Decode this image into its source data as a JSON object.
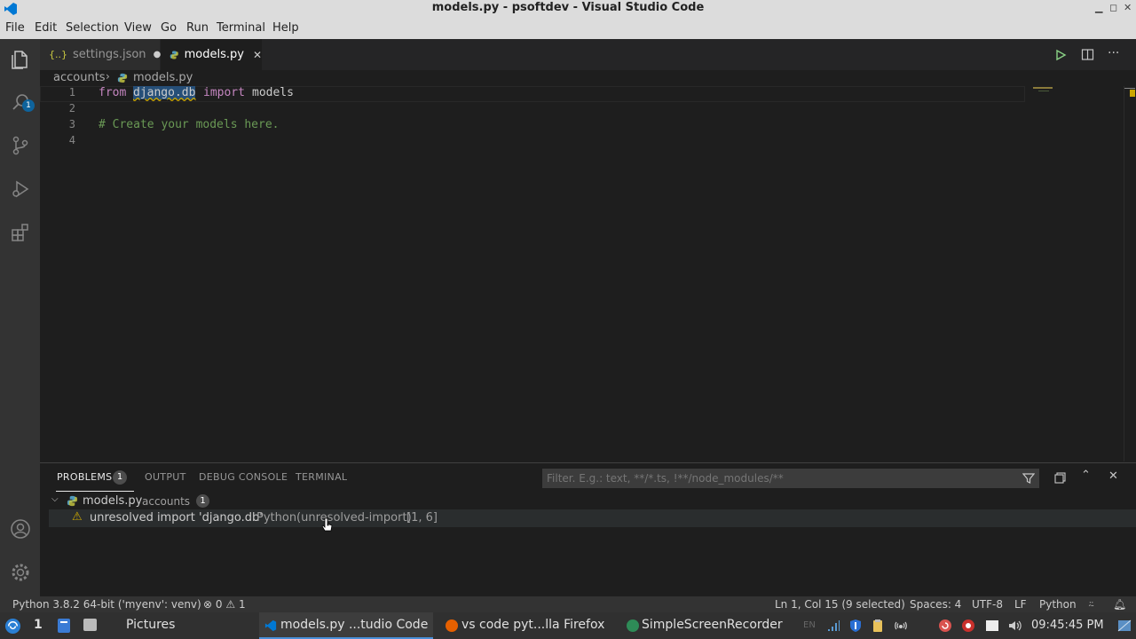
{
  "window": {
    "title": "models.py - psoftdev - Visual Studio Code"
  },
  "menu": [
    "File",
    "Edit",
    "Selection",
    "View",
    "Go",
    "Run",
    "Terminal",
    "Help"
  ],
  "activity": {
    "explorer_badge": "1"
  },
  "tabs": [
    {
      "label": "settings.json",
      "icon": "json-braces-icon",
      "dirty": true
    },
    {
      "label": "models.py",
      "icon": "python-icon",
      "active": true
    }
  ],
  "breadcrumb": {
    "folder": "accounts",
    "file": "models.py"
  },
  "editor": {
    "lines": [
      {
        "num": "1",
        "kw1": "from",
        "module": "django.db",
        "kw2": "import",
        "name": "models"
      },
      {
        "num": "2"
      },
      {
        "num": "3",
        "comment": "# Create your models here."
      },
      {
        "num": "4"
      }
    ]
  },
  "panel": {
    "tabs": {
      "problems": "PROBLEMS",
      "output": "OUTPUT",
      "debug": "DEBUG CONSOLE",
      "terminal": "TERMINAL"
    },
    "problems_count": "1",
    "filter_placeholder": "Filter. E.g.: text, **/*.ts, !**/node_modules/**",
    "file_group": {
      "file": "models.py",
      "folder": "accounts",
      "count": "1"
    },
    "problem": {
      "message": "unresolved import 'django.db'",
      "source": "Python(unresolved-import)",
      "location": "[1, 6]"
    }
  },
  "status": {
    "interpreter": "Python 3.8.2 64-bit ('myenv': venv)",
    "errors": "0",
    "warnings": "1",
    "position": "Ln 1, Col 15 (9 selected)",
    "spaces": "Spaces: 4",
    "encoding": "UTF-8",
    "eol": "LF",
    "language": "Python"
  },
  "taskbar": {
    "workspace": "1",
    "items": [
      "Pictures",
      "models.py ...tudio Code",
      "vs code pyt...lla Firefox",
      "SimpleScreenRecorder"
    ],
    "lang": "EN",
    "clock": "09:45:45 PM"
  },
  "colors": {
    "accent": "#007acc",
    "warning": "#cca700",
    "statusbar": "#333333"
  }
}
